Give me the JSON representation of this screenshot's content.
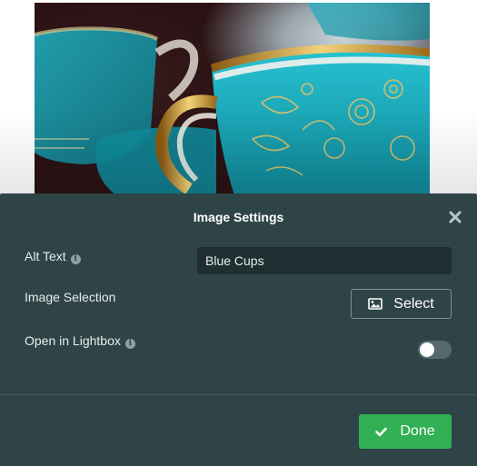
{
  "photo": {
    "alt": "Blue Cups"
  },
  "panel": {
    "title": "Image Settings",
    "alt_text": {
      "label": "Alt Text",
      "value": "Blue Cups"
    },
    "image_selection": {
      "label": "Image Selection",
      "button_label": "Select"
    },
    "lightbox": {
      "label": "Open in Lightbox",
      "enabled": false
    },
    "done_label": "Done"
  },
  "colors": {
    "panel_bg": "#2f4447",
    "done_green": "#31b055",
    "cup_teal": "#1aa6b7",
    "gold": "#d9a441"
  },
  "icons": [
    "close-icon",
    "info-icon",
    "image-icon",
    "check-icon"
  ]
}
